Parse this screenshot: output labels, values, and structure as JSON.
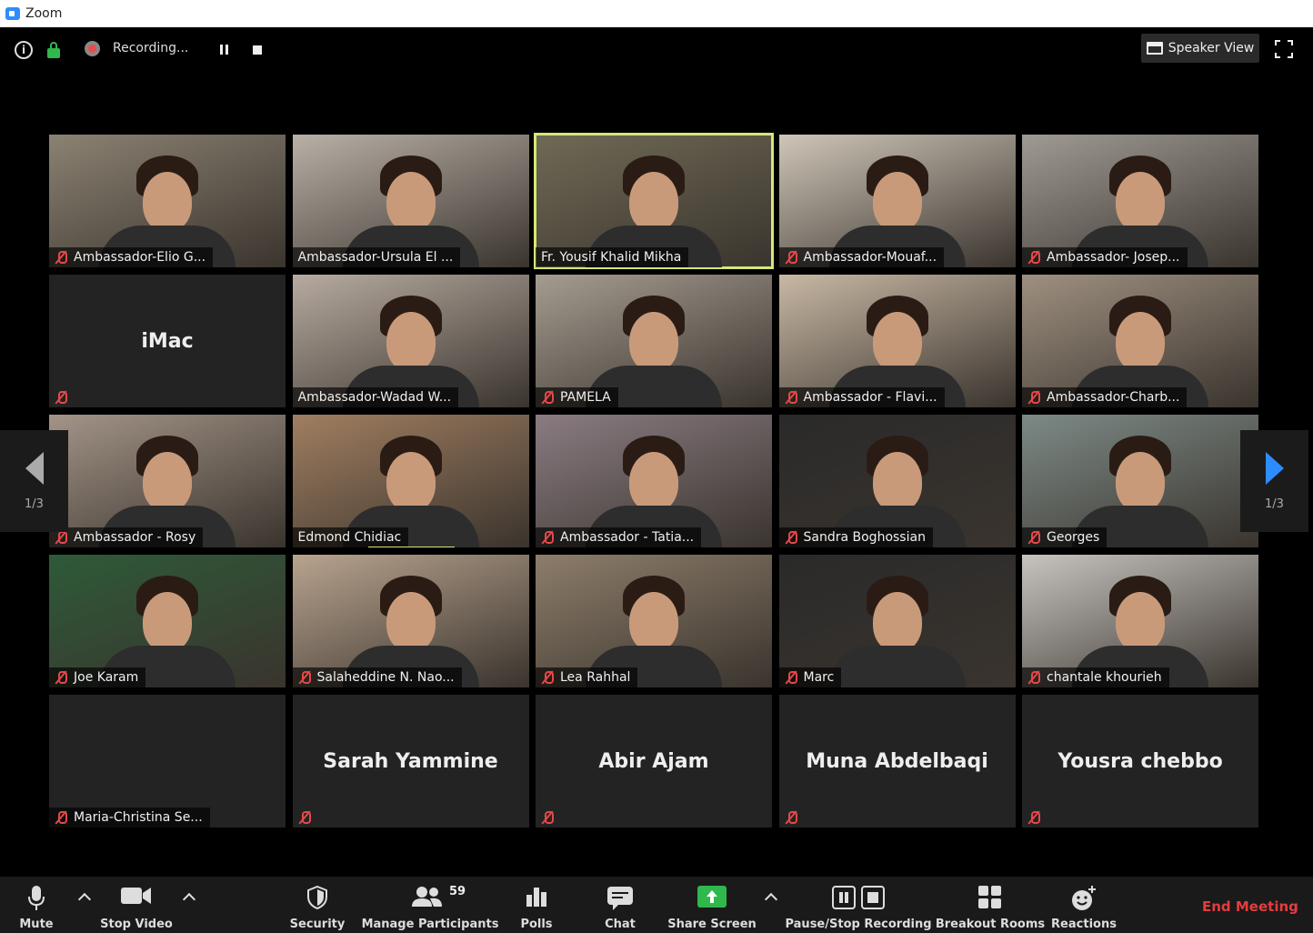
{
  "titlebar": {
    "title": "Zoom"
  },
  "topbar": {
    "recording_label": "Recording...",
    "speaker_view_label": "Speaker View"
  },
  "tiles": [
    {
      "name": "Ambassador-Elio G...",
      "video": true,
      "muted": true
    },
    {
      "name": "Ambassador-Ursula El ...",
      "video": true,
      "muted": false
    },
    {
      "name": "Fr. Yousif Khalid Mikha",
      "video": true,
      "muted": false,
      "active": true
    },
    {
      "name": "Ambassador-Mouaf...",
      "video": true,
      "muted": true
    },
    {
      "name": "Ambassador- Josep...",
      "video": true,
      "muted": true
    },
    {
      "name": "",
      "center": "iMac",
      "video": false,
      "muted": true
    },
    {
      "name": "Ambassador-Wadad W...",
      "video": true,
      "muted": false
    },
    {
      "name": "PAMELA",
      "video": true,
      "muted": true
    },
    {
      "name": "Ambassador - Flavi...",
      "video": true,
      "muted": true
    },
    {
      "name": "Ambassador-Charb...",
      "video": true,
      "muted": true
    },
    {
      "name": "Ambassador - Rosy",
      "video": true,
      "muted": true
    },
    {
      "name": "Edmond Chidiac",
      "video": true,
      "muted": false,
      "speaking": true
    },
    {
      "name": "Ambassador - Tatia...",
      "video": true,
      "muted": true
    },
    {
      "name": "Sandra Boghossian",
      "video": true,
      "muted": true
    },
    {
      "name": "Georges",
      "video": true,
      "muted": true
    },
    {
      "name": "Joe Karam",
      "video": true,
      "muted": true
    },
    {
      "name": "Salaheddine N. Nao...",
      "video": true,
      "muted": true
    },
    {
      "name": "Lea Rahhal",
      "video": true,
      "muted": true
    },
    {
      "name": "Marc",
      "video": true,
      "muted": true
    },
    {
      "name": "chantale khourieh",
      "video": true,
      "muted": true
    },
    {
      "name": "Maria-Christina Se...",
      "video": false,
      "muted": true
    },
    {
      "name": "",
      "center": "Sarah Yammine",
      "video": false,
      "muted": true
    },
    {
      "name": "",
      "center": "Abir Ajam",
      "video": false,
      "muted": true
    },
    {
      "name": "",
      "center": "Muna Abdelbaqi",
      "video": false,
      "muted": true
    },
    {
      "name": "",
      "center": "Yousra chebbo",
      "video": false,
      "muted": true
    }
  ],
  "pager": {
    "left_label": "1/3",
    "right_label": "1/3"
  },
  "toolbar": {
    "mute": "Mute",
    "stop_video": "Stop Video",
    "security": "Security",
    "manage_participants": "Manage Participants",
    "participant_count": "59",
    "polls": "Polls",
    "chat": "Chat",
    "share_screen": "Share Screen",
    "pause_stop_recording": "Pause/Stop Recording",
    "breakout_rooms": "Breakout Rooms",
    "reactions": "Reactions",
    "end_meeting": "End Meeting"
  },
  "colors": {
    "accent_blue": "#2d8cff",
    "speaking_border": "#d7e67a",
    "muted_red": "#e54848",
    "end_red": "#e53d3d",
    "share_green": "#2fb84b"
  }
}
